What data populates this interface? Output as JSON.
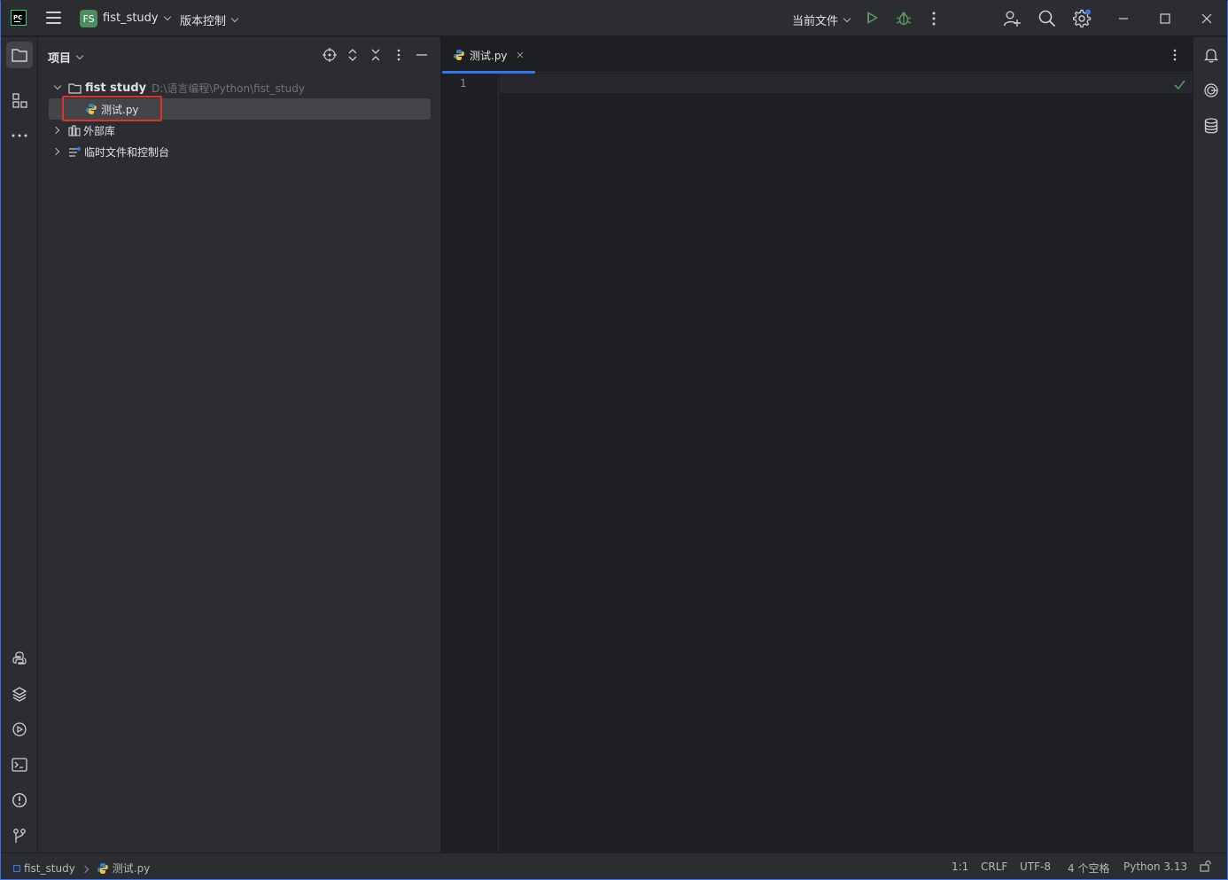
{
  "app": {
    "logo_text": "PC"
  },
  "titlebar": {
    "project_badge": "FS",
    "project_name": "fist_study",
    "vcs_label": "版本控制",
    "run_config": "当前文件"
  },
  "project_panel": {
    "title": "项目",
    "tree": [
      {
        "label": "fist study",
        "path": "D:\\语言编程\\Python\\fist_study",
        "expanded": true
      },
      {
        "label": "测试.py",
        "selected": true
      },
      {
        "label": "外部库",
        "expanded": false
      },
      {
        "label": "临时文件和控制台",
        "expanded": false
      }
    ]
  },
  "editor": {
    "tabs": [
      {
        "label": "测试.py",
        "active": true
      }
    ],
    "line_numbers": [
      "1"
    ]
  },
  "statusbar": {
    "breadcrumb_project": "fist_study",
    "breadcrumb_file": "测试.py",
    "caret_position": "1:1",
    "line_separator": "CRLF",
    "encoding": "UTF-8",
    "indent": "4 个空格",
    "interpreter": "Python 3.13"
  },
  "colors": {
    "accent": "#3574f0",
    "run_green": "#57965c",
    "project_badge": "#4a8d61",
    "highlight_red": "#e0312e"
  }
}
